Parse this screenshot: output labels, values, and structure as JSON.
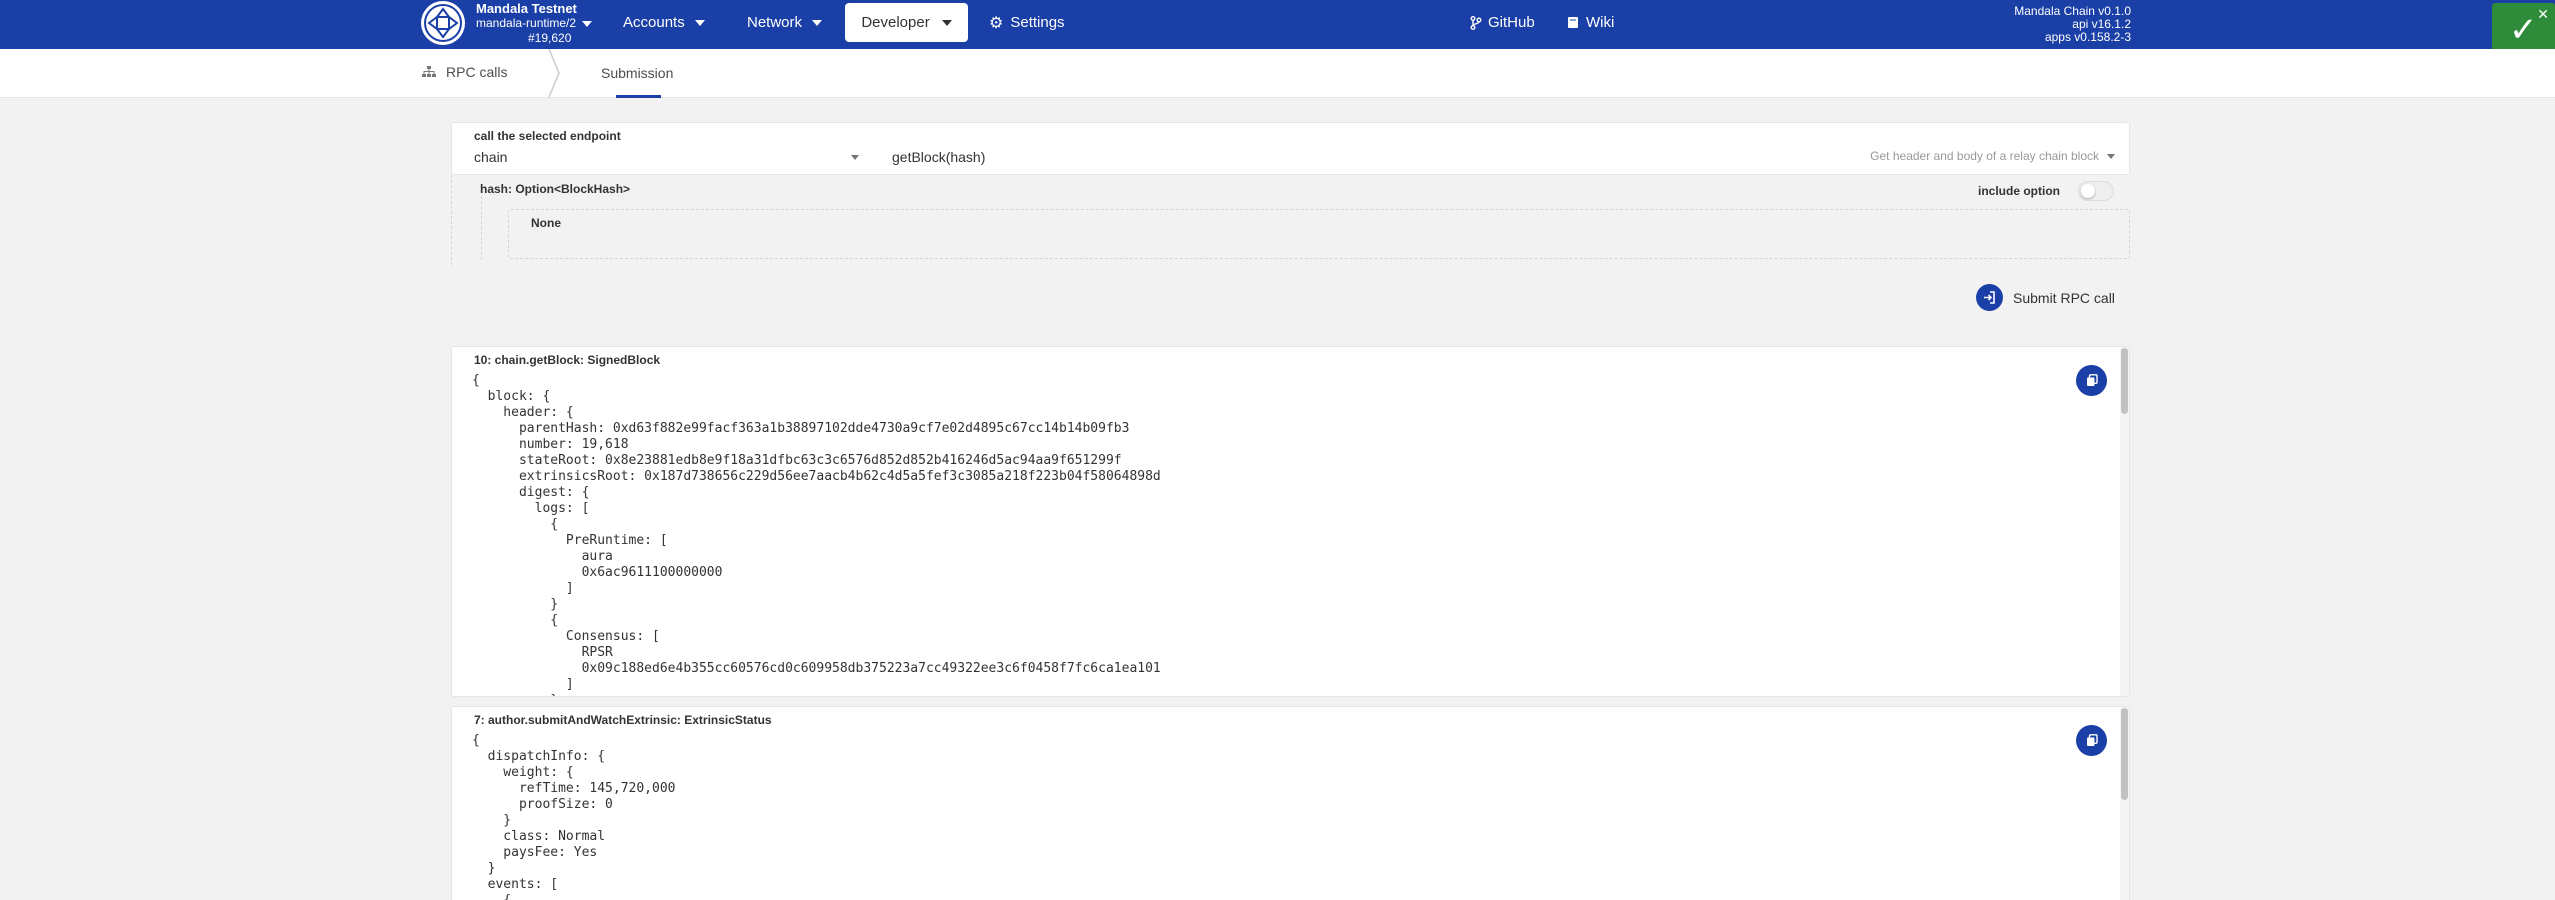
{
  "header": {
    "chain_name": "Mandala Testnet",
    "runtime": "mandala-runtime/2",
    "block_number": "#19,620",
    "nav": {
      "accounts": "Accounts",
      "network": "Network",
      "developer": "Developer",
      "settings": "Settings",
      "github": "GitHub",
      "wiki": "Wiki"
    },
    "versions": {
      "node": "Mandala Chain v0.1.0",
      "api": "api v16.1.2",
      "apps": "apps v0.158.2-3"
    },
    "brand_color": "#1a3fa6"
  },
  "tabs": {
    "rpc_calls": "RPC calls",
    "submission": "Submission"
  },
  "endpoint": {
    "label": "call the selected endpoint",
    "section": "chain",
    "method": "getBlock(hash)",
    "description": "Get header and body of a relay chain block"
  },
  "param": {
    "label": "hash: Option<BlockHash>",
    "include_option_label": "include option",
    "include_option_enabled": false,
    "value": "None"
  },
  "submit_label": "Submit RPC call",
  "outputs": [
    {
      "title": "10: chain.getBlock: SignedBlock",
      "lines": [
        "{",
        "  block: {",
        "    header: {",
        "      parentHash: 0xd63f882e99facf363a1b38897102dde4730a9cf7e02d4895c67cc14b14b09fb3",
        "      number: 19,618",
        "      stateRoot: 0x8e23881edb8e9f18a31dfbc63c3c6576d852d852b416246d5ac94aa9f651299f",
        "      extrinsicsRoot: 0x187d738656c229d56ee7aacb4b62c4d5a5fef3c3085a218f223b04f58064898d",
        "      digest: {",
        "        logs: [",
        "          {",
        "            PreRuntime: [",
        "              aura",
        "              0x6ac9611100000000",
        "            ]",
        "          }",
        "          {",
        "            Consensus: [",
        "              RPSR",
        "              0x09c188ed6e4b355cc60576cd0c609958db375223a7cc49322ee3c6f0458f7fc6ca1ea101",
        "            ]",
        "          }"
      ]
    },
    {
      "title": "7: author.submitAndWatchExtrinsic: ExtrinsicStatus",
      "lines": [
        "{",
        "  dispatchInfo: {",
        "    weight: {",
        "      refTime: 145,720,000",
        "      proofSize: 0",
        "    }",
        "    class: Normal",
        "    paysFee: Yes",
        "  }",
        "  events: [",
        "    {"
      ]
    }
  ]
}
